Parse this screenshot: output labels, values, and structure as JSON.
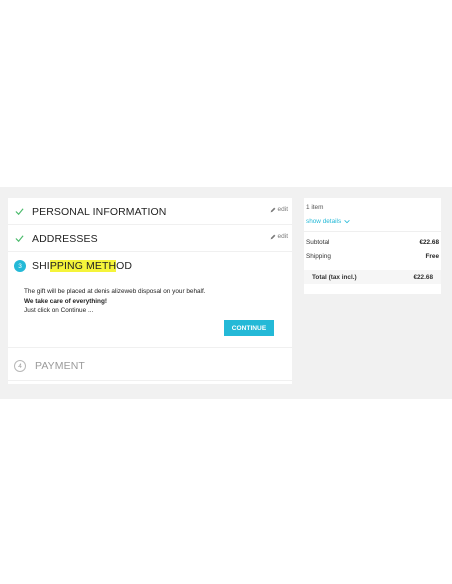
{
  "checkout": {
    "steps": [
      {
        "title": "PERSONAL INFORMATION",
        "status": "complete",
        "edit_label": "edit"
      },
      {
        "title": "ADDRESSES",
        "status": "complete",
        "edit_label": "edit"
      },
      {
        "number": "3",
        "title_part1": "SHI",
        "title_highlight": "PPING METH",
        "title_part2": "OD",
        "status": "current"
      },
      {
        "number": "4",
        "title": "PAYMENT",
        "status": "pending"
      }
    ],
    "shipping": {
      "line1": "The gift will be placed at denis alizeweb disposal on your behalf.",
      "line2": "We take care of everything!",
      "line3": "Just click on Continue ...",
      "continue_label": "CONTINUE"
    }
  },
  "summary": {
    "items_count": "1 item",
    "show_details": "show details",
    "subtotal_label": "Subtotal",
    "subtotal_value": "€22.68",
    "shipping_label": "Shipping",
    "shipping_value": "Free",
    "total_label": "Total (tax incl.)",
    "total_value": "€22.68"
  },
  "colors": {
    "accent": "#24b9d7",
    "highlight": "#f5f43a",
    "check": "#4cbb6c",
    "band": "#f1f1f1"
  }
}
